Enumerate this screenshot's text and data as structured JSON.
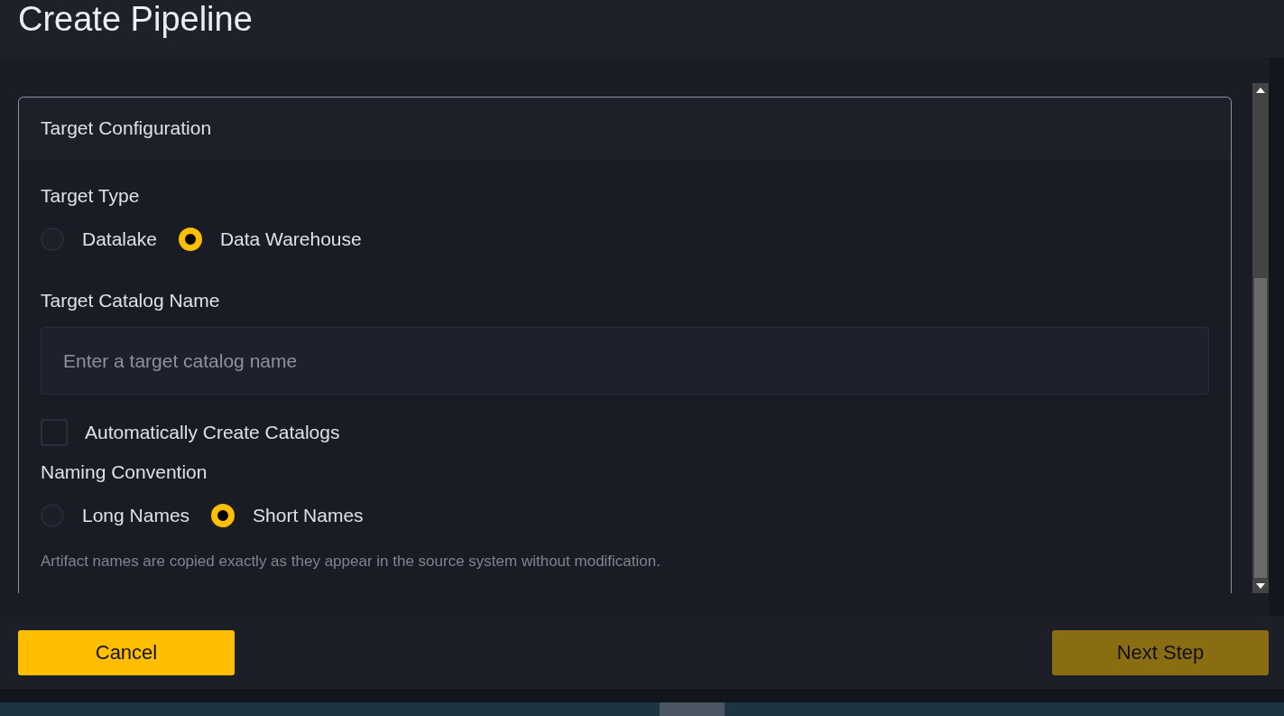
{
  "page": {
    "title": "Create Pipeline"
  },
  "card": {
    "title": "Target Configuration"
  },
  "target_type": {
    "label": "Target Type",
    "options": [
      {
        "label": "Datalake",
        "selected": false
      },
      {
        "label": "Data Warehouse",
        "selected": true
      }
    ]
  },
  "catalog_name": {
    "label": "Target Catalog Name",
    "placeholder": "Enter a target catalog name"
  },
  "auto_create": {
    "label": "Automatically Create Catalogs",
    "checked": false
  },
  "naming_convention": {
    "label": "Naming Convention",
    "options": [
      {
        "label": "Long Names",
        "selected": false
      },
      {
        "label": "Short Names",
        "selected": true
      }
    ],
    "hint": "Artifact names are copied exactly as they appear in the source system without modification."
  },
  "buttons": [
    {
      "label": "Cancel",
      "disabled": false
    },
    {
      "label": "Next Step",
      "disabled": true
    }
  ]
}
